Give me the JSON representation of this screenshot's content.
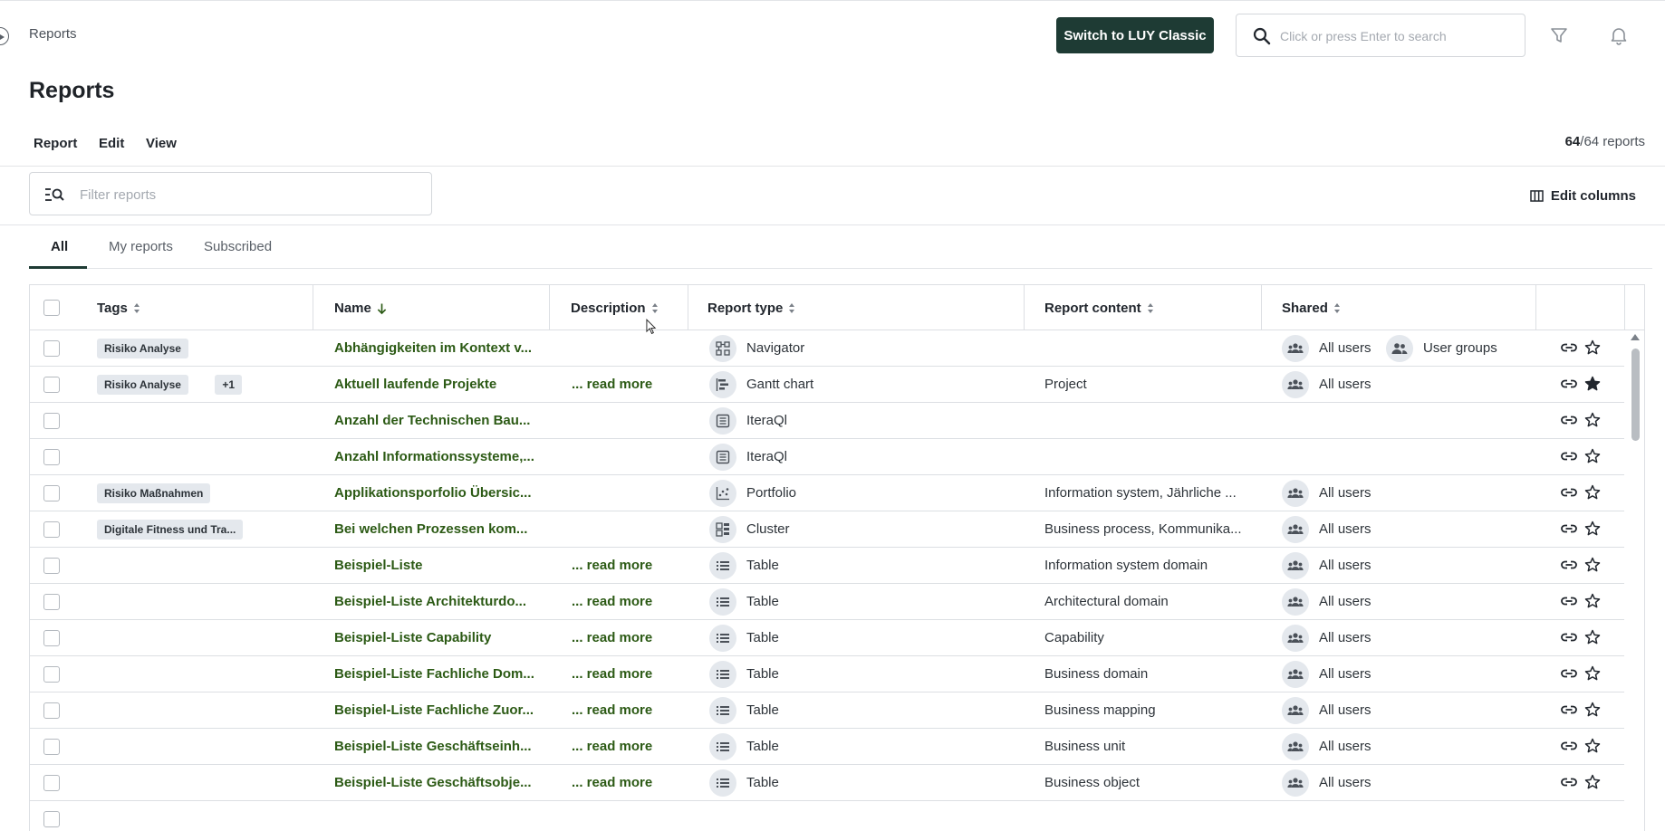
{
  "breadcrumb": "Reports",
  "header": {
    "switch_label": "Switch to LUY Classic",
    "search_placeholder": "Click or press Enter to search",
    "filter_icon": "filter-icon",
    "bell_icon": "bell-icon"
  },
  "page_title": "Reports",
  "menu": {
    "report": "Report",
    "edit": "Edit",
    "view": "View"
  },
  "count": {
    "shown": "64",
    "rest": "/64 reports"
  },
  "filter": {
    "placeholder": "Filter reports"
  },
  "edit_columns": "Edit columns",
  "tabs": {
    "all": "All",
    "my": "My reports",
    "subscribed": "Subscribed"
  },
  "columns": {
    "tags": "Tags",
    "name": "Name",
    "description": "Description",
    "report_type": "Report type",
    "report_content": "Report content",
    "shared": "Shared"
  },
  "rows": [
    {
      "tags": [
        "Risiko Analyse"
      ],
      "name": "Abhängigkeiten im Kontext v...",
      "description": "",
      "type": "Navigator",
      "type_icon": "navigator-icon",
      "content": "",
      "shared": [
        "All users",
        "User groups"
      ],
      "starred": false
    },
    {
      "tags": [
        "Risiko Analyse",
        "+1"
      ],
      "name": "Aktuell laufende Projekte",
      "description": "... read more",
      "type": "Gantt chart",
      "type_icon": "gantt-icon",
      "content": "Project",
      "shared": [
        "All users"
      ],
      "starred": true
    },
    {
      "tags": [],
      "name": "Anzahl der Technischen Bau...",
      "description": "",
      "type": "IteraQl",
      "type_icon": "iteraql-icon",
      "content": "",
      "shared": [],
      "starred": false
    },
    {
      "tags": [],
      "name": "Anzahl Informationssysteme,...",
      "description": "",
      "type": "IteraQl",
      "type_icon": "iteraql-icon",
      "content": "",
      "shared": [],
      "starred": false
    },
    {
      "tags": [
        "Risiko Maßnahmen"
      ],
      "name": "Applikationsporfolio Übersic...",
      "description": "",
      "type": "Portfolio",
      "type_icon": "portfolio-icon",
      "content": "Information system, Jährliche ...",
      "shared": [
        "All users"
      ],
      "starred": false
    },
    {
      "tags": [
        "Digitale Fitness und Tra..."
      ],
      "name": "Bei welchen Prozessen kom...",
      "description": "",
      "type": "Cluster",
      "type_icon": "cluster-icon",
      "content": "Business process, Kommunika...",
      "shared": [
        "All users"
      ],
      "starred": false
    },
    {
      "tags": [],
      "name": "Beispiel-Liste",
      "description": "... read more",
      "type": "Table",
      "type_icon": "table-icon",
      "content": "Information system domain",
      "shared": [
        "All users"
      ],
      "starred": false
    },
    {
      "tags": [],
      "name": "Beispiel-Liste Architekturdo...",
      "description": "... read more",
      "type": "Table",
      "type_icon": "table-icon",
      "content": "Architectural domain",
      "shared": [
        "All users"
      ],
      "starred": false
    },
    {
      "tags": [],
      "name": "Beispiel-Liste Capability",
      "description": "... read more",
      "type": "Table",
      "type_icon": "table-icon",
      "content": "Capability",
      "shared": [
        "All users"
      ],
      "starred": false
    },
    {
      "tags": [],
      "name": "Beispiel-Liste Fachliche Dom...",
      "description": "... read more",
      "type": "Table",
      "type_icon": "table-icon",
      "content": "Business domain",
      "shared": [
        "All users"
      ],
      "starred": false
    },
    {
      "tags": [],
      "name": "Beispiel-Liste Fachliche Zuor...",
      "description": "... read more",
      "type": "Table",
      "type_icon": "table-icon",
      "content": "Business mapping",
      "shared": [
        "All users"
      ],
      "starred": false
    },
    {
      "tags": [],
      "name": "Beispiel-Liste Geschäftseinh...",
      "description": "... read more",
      "type": "Table",
      "type_icon": "table-icon",
      "content": "Business unit",
      "shared": [
        "All users"
      ],
      "starred": false
    },
    {
      "tags": [],
      "name": "Beispiel-Liste Geschäftsobje...",
      "description": "... read more",
      "type": "Table",
      "type_icon": "table-icon",
      "content": "Business object",
      "shared": [
        "All users"
      ],
      "starred": false
    }
  ]
}
